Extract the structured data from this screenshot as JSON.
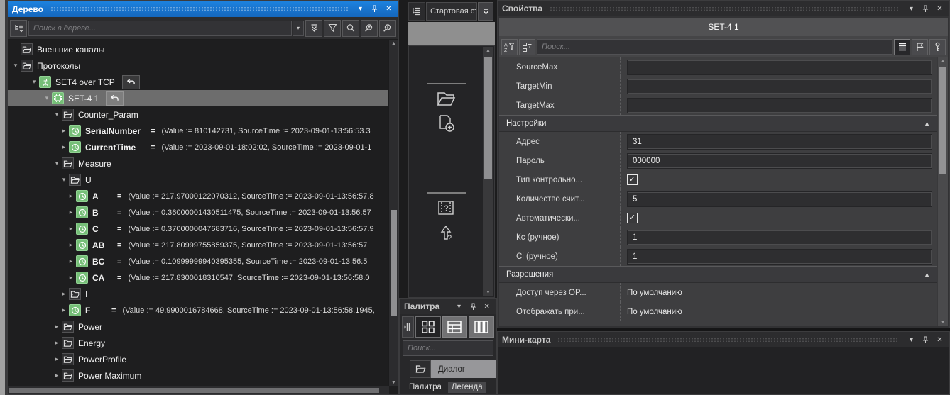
{
  "colors": {
    "accent_blue": "#1a78d7",
    "selection_gray": "#6d6d6d",
    "icon_green": "#76bf78"
  },
  "controls": {
    "menu_glyph": "▾",
    "close_glyph": "✕"
  },
  "tree": {
    "title": "Дерево",
    "search_placeholder": "Поиск в дереве...",
    "items": [
      {
        "label": "Внешние каналы",
        "level": 0,
        "icon": "folder",
        "exp": "none"
      },
      {
        "label": "Протоколы",
        "level": 0,
        "icon": "folder",
        "exp": "open"
      },
      {
        "label": "SET4 over TCP",
        "level": 1,
        "icon": "protocol",
        "exp": "open",
        "undo": true
      },
      {
        "label": "SET-4 1",
        "level": 2,
        "icon": "device",
        "exp": "open",
        "undo": true,
        "selected": true
      },
      {
        "label": "Counter_Param",
        "level": 3,
        "icon": "folder",
        "exp": "open"
      },
      {
        "label": "SerialNumber",
        "level": 4,
        "icon": "channel",
        "exp": "closed",
        "eq": "=",
        "name_w": 92,
        "value": "(Value := 810142731, SourceTime := 2023-09-01-13:56:53.3"
      },
      {
        "label": "CurrentTime",
        "level": 4,
        "icon": "channel",
        "exp": "closed",
        "eq": "=",
        "name_w": 92,
        "value": "(Value := 2023-09-01-18:02:02, SourceTime := 2023-09-01-1"
      },
      {
        "label": "Measure",
        "level": 3,
        "icon": "folder",
        "exp": "open"
      },
      {
        "label": "U",
        "level": 4,
        "icon": "folder",
        "exp": "open"
      },
      {
        "label": "A",
        "level": 5,
        "icon": "channel",
        "exp": "closed",
        "eq": "=",
        "name_w": 35,
        "value": "(Value := 217.97000122070312, SourceTime := 2023-09-01-13:56:57.8"
      },
      {
        "label": "B",
        "level": 5,
        "icon": "channel",
        "exp": "closed",
        "eq": "=",
        "name_w": 35,
        "value": "(Value := 0.36000001430511475, SourceTime := 2023-09-01-13:56:57"
      },
      {
        "label": "C",
        "level": 5,
        "icon": "channel",
        "exp": "closed",
        "eq": "=",
        "name_w": 35,
        "value": "(Value := 0.3700000047683716, SourceTime := 2023-09-01-13:56:57.9"
      },
      {
        "label": "AB",
        "level": 5,
        "icon": "channel",
        "exp": "closed",
        "eq": "=",
        "name_w": 35,
        "value": "(Value := 217.80999755859375, SourceTime := 2023-09-01-13:56:57"
      },
      {
        "label": "BC",
        "level": 5,
        "icon": "channel",
        "exp": "closed",
        "eq": "=",
        "name_w": 35,
        "value": "(Value := 0.10999999940395355, SourceTime := 2023-09-01-13:56:5"
      },
      {
        "label": "CA",
        "level": 5,
        "icon": "channel",
        "exp": "closed",
        "eq": "=",
        "name_w": 35,
        "value": "(Value := 217.8300018310547, SourceTime := 2023-09-01-13:56:58.0"
      },
      {
        "label": "I",
        "level": 4,
        "icon": "folder",
        "exp": "closed"
      },
      {
        "label": "F",
        "level": 4,
        "icon": "channel",
        "exp": "closed",
        "eq": "=",
        "name_w": 37,
        "value": "(Value := 49.9900016784668, SourceTime := 2023-09-01-13:56:58.1945,"
      },
      {
        "label": "Power",
        "level": 3,
        "icon": "folder",
        "exp": "closed"
      },
      {
        "label": "Energy",
        "level": 3,
        "icon": "folder",
        "exp": "closed"
      },
      {
        "label": "PowerProfile",
        "level": 3,
        "icon": "folder",
        "exp": "closed"
      },
      {
        "label": "Power Maximum",
        "level": 3,
        "icon": "folder",
        "exp": "closed"
      }
    ]
  },
  "document": {
    "tab_label": "Стартовая ст"
  },
  "palette": {
    "title": "Палитра",
    "search_placeholder": "Поиск...",
    "category_label": "Диалог",
    "tabs": [
      "Палитра",
      "Легенда"
    ]
  },
  "properties": {
    "title": "Свойства",
    "object_name": "SET-4 1",
    "search_placeholder": "Поиск...",
    "check_glyph": "✓",
    "collapse_glyph": "▲",
    "rows": [
      {
        "type": "field",
        "label": "SourceMax",
        "value": ""
      },
      {
        "type": "field",
        "label": "TargetMin",
        "value": ""
      },
      {
        "type": "field",
        "label": "TargetMax",
        "value": ""
      },
      {
        "type": "section",
        "label": "Настройки"
      },
      {
        "type": "field",
        "label": "Адрес",
        "value": "31"
      },
      {
        "type": "field",
        "label": "Пароль",
        "value": "000000"
      },
      {
        "type": "checkbox",
        "label": "Тип контрольно...",
        "checked": true
      },
      {
        "type": "field",
        "label": "Количество счит...",
        "value": "5"
      },
      {
        "type": "checkbox",
        "label": "Автоматически...",
        "checked": true
      },
      {
        "type": "field",
        "label": "Кс (ручное)",
        "value": "1"
      },
      {
        "type": "field",
        "label": "Ci (ручное)",
        "value": "1"
      },
      {
        "type": "section",
        "label": "Разрешения"
      },
      {
        "type": "text",
        "label": "Доступ через OP...",
        "value": "По умолчанию"
      },
      {
        "type": "text",
        "label": "Отображать при...",
        "value": "По умолчанию"
      }
    ]
  },
  "minimap": {
    "title": "Мини-карта"
  }
}
